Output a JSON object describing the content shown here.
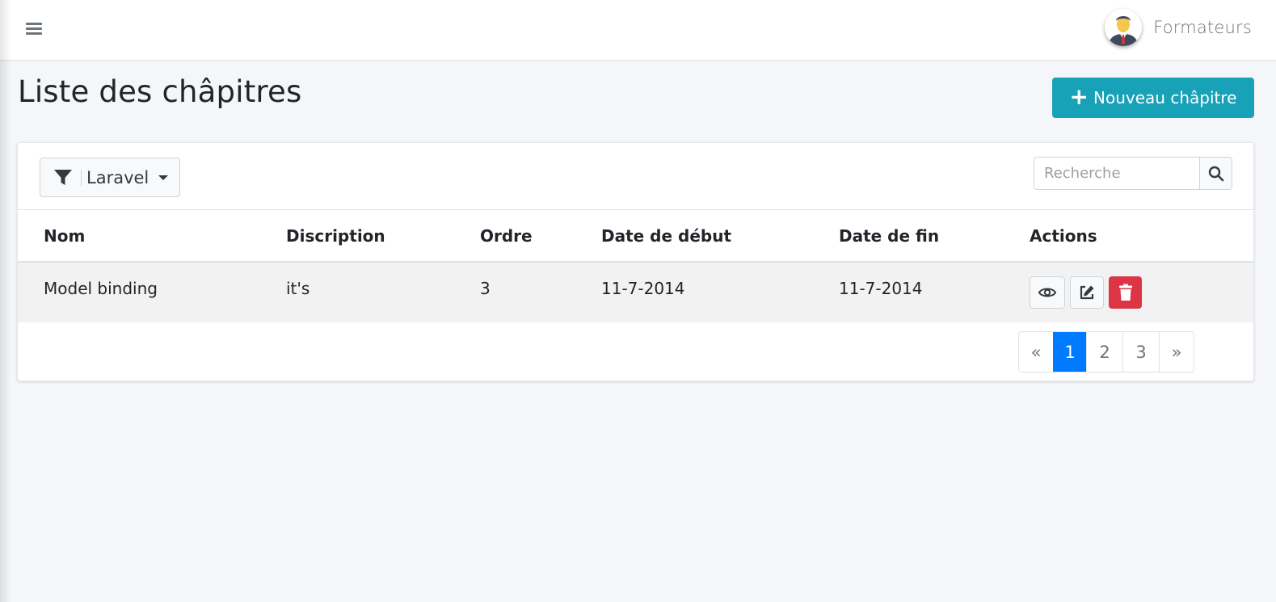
{
  "navbar": {
    "menu_icon": "hamburger-icon",
    "user_name": "Formateurs",
    "avatar_icon": "user-avatar"
  },
  "header": {
    "title": "Liste des châpitres",
    "new_button_label": "Nouveau châpitre",
    "new_button_icon": "plus-icon"
  },
  "toolbar": {
    "filter_icon": "funnel-icon",
    "filter_value": "Laravel",
    "search_placeholder": "Recherche",
    "search_icon": "search-icon"
  },
  "table": {
    "columns": [
      "Nom",
      "Discription",
      "Ordre",
      "Date de début",
      "Date de fin",
      "Actions"
    ],
    "rows": [
      {
        "nom": "Model binding",
        "discription": "it's",
        "ordre": "3",
        "date_debut": "11-7-2014",
        "date_fin": "11-7-2014",
        "actions": [
          "eye-icon",
          "edit-icon",
          "trash-icon"
        ]
      }
    ]
  },
  "pagination": {
    "prev": "«",
    "pages": [
      "1",
      "2",
      "3"
    ],
    "active_page": "1",
    "next": "»"
  },
  "colors": {
    "primary": "#007bff",
    "info": "#17a2b8",
    "danger": "#dc3545",
    "background": "#f4f6f9"
  }
}
